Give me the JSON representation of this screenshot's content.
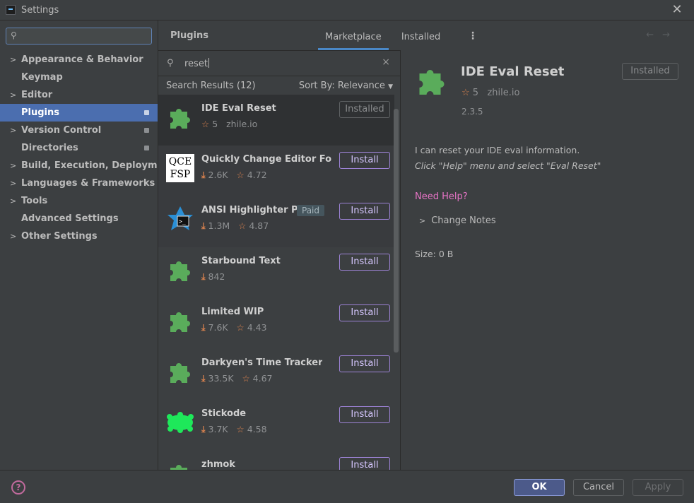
{
  "window": {
    "title": "Settings",
    "close_glyph": "✕"
  },
  "sidebar": {
    "search_placeholder": "",
    "items": [
      {
        "label": "Appearance & Behavior",
        "has_children": true
      },
      {
        "label": "Keymap",
        "has_children": false
      },
      {
        "label": "Editor",
        "has_children": true
      },
      {
        "label": "Plugins",
        "has_children": false,
        "selected": true,
        "badge": true
      },
      {
        "label": "Version Control",
        "has_children": true,
        "badge": true
      },
      {
        "label": "Directories",
        "has_children": false,
        "badge": true
      },
      {
        "label": "Build, Execution, Deployment",
        "has_children": true
      },
      {
        "label": "Languages & Frameworks",
        "has_children": true
      },
      {
        "label": "Tools",
        "has_children": true
      },
      {
        "label": "Advanced Settings",
        "has_children": false
      },
      {
        "label": "Other Settings",
        "has_children": true
      }
    ]
  },
  "header": {
    "title": "Plugins",
    "tabs": [
      {
        "label": "Marketplace",
        "active": true
      },
      {
        "label": "Installed",
        "active": false
      }
    ],
    "more_glyph": "⋮",
    "back_glyph": "←",
    "forward_glyph": "→"
  },
  "search": {
    "query": "reset",
    "clear_glyph": "×"
  },
  "results": {
    "count_label": "Search Results (12)",
    "sort_label": "Sort By: Relevance",
    "items": [
      {
        "name": "IDE Eval Reset",
        "stars": "5",
        "vendor": "zhile.io",
        "downloads": "",
        "action": "Installed",
        "icon": "puzzle-icon",
        "selected": true
      },
      {
        "name": "Quickly Change Editor Font ...",
        "downloads": "2.6K",
        "stars": "4.72",
        "action": "Install",
        "icon": "qce-fsp-logo",
        "icon_text": [
          "QCE",
          "FSP"
        ]
      },
      {
        "name": "ANSI Highlighter P...",
        "downloads": "1.3M",
        "stars": "4.87",
        "action": "Install",
        "icon": "ansi-logo",
        "paid": "Paid"
      },
      {
        "name": "Starbound Text",
        "downloads": "842",
        "stars": "",
        "action": "Install",
        "icon": "puzzle-icon"
      },
      {
        "name": "Limited WIP",
        "downloads": "7.6K",
        "stars": "4.43",
        "action": "Install",
        "icon": "puzzle-icon"
      },
      {
        "name": "Darkyen's Time Tracker",
        "downloads": "33.5K",
        "stars": "4.67",
        "action": "Install",
        "icon": "puzzle-icon"
      },
      {
        "name": "Stickode",
        "downloads": "3.7K",
        "stars": "4.58",
        "action": "Install",
        "icon": "stickode-logo"
      },
      {
        "name": "zhmok",
        "downloads": "",
        "stars": "",
        "action": "Install",
        "icon": "puzzle-icon"
      }
    ]
  },
  "detail": {
    "title": "IDE Eval Reset",
    "action": "Installed",
    "stars": "5",
    "vendor": "zhile.io",
    "version": "2.3.5",
    "description": "I can reset your IDE eval information.",
    "hint": "Click \"Help\" menu and select \"Eval Reset\"",
    "help_link": "Need Help?",
    "change_notes": "Change Notes",
    "size": "Size: 0 B"
  },
  "footer": {
    "help_glyph": "?",
    "ok": "OK",
    "cancel": "Cancel",
    "apply": "Apply"
  },
  "colors": {
    "accent": "#4b6eaf",
    "install_border": "#9d83d6",
    "rating": "#d8814e",
    "link": "#e774c6",
    "plugin_green": "#5aac5b"
  }
}
